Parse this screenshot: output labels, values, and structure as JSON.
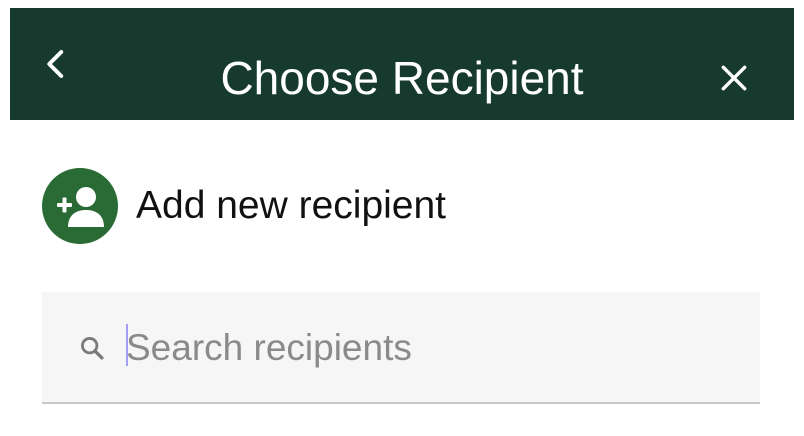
{
  "header": {
    "title": "Choose Recipient",
    "back_icon": "chevron-left-icon",
    "close_icon": "close-icon",
    "background_color": "#173a2f"
  },
  "add_recipient": {
    "label": "Add new recipient",
    "icon": "add-person-icon",
    "avatar_color": "#2a6b35"
  },
  "search": {
    "placeholder": "Search recipients",
    "value": "",
    "icon": "search-icon"
  }
}
